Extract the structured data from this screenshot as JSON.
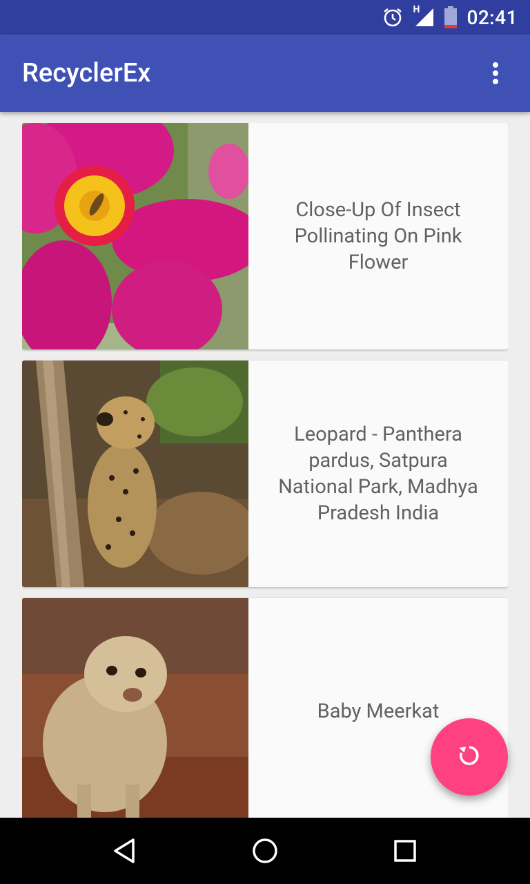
{
  "status_bar": {
    "time": "02:41",
    "network_label": "H",
    "icons": [
      "alarm-icon",
      "signal-icon",
      "battery-icon"
    ]
  },
  "app_bar": {
    "title": "RecyclerEx",
    "overflow_icon": "more-vert-icon"
  },
  "items": [
    {
      "title": "Close-Up Of Insect Pollinating On Pink Flower",
      "image": "pink-flower-photo"
    },
    {
      "title": "Leopard - Panthera pardus, Satpura National Park, Madhya Pradesh India",
      "image": "leopard-photo"
    },
    {
      "title": "Baby Meerkat",
      "image": "meerkat-photo"
    }
  ],
  "fab": {
    "icon": "refresh-icon",
    "color": "#ff4081"
  },
  "nav_bar": {
    "buttons": [
      "back-icon",
      "home-icon",
      "recents-icon"
    ]
  },
  "colors": {
    "primary": "#3f51b5",
    "primary_dark": "#303f9f",
    "accent": "#ff4081"
  }
}
